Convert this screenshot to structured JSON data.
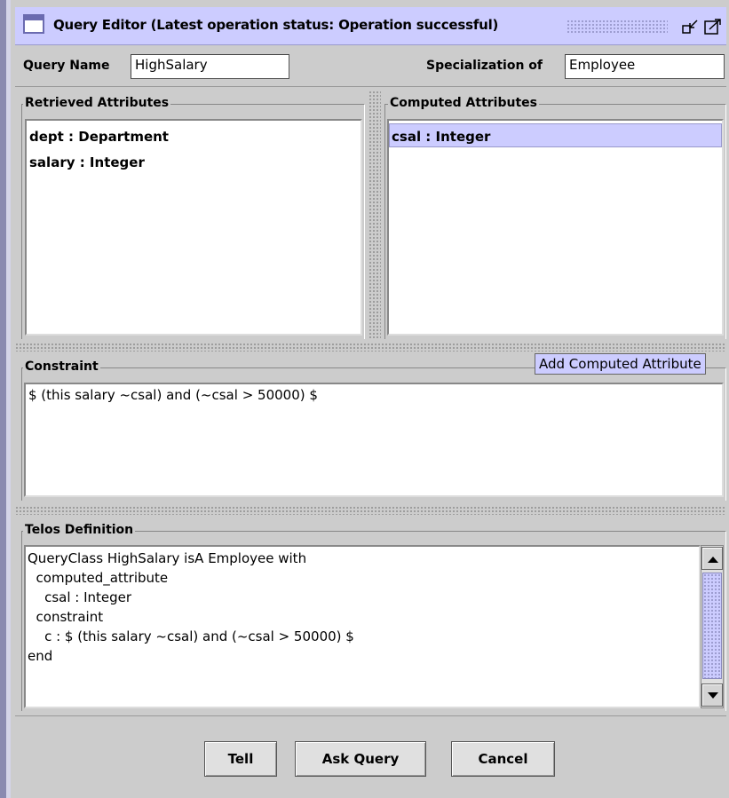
{
  "window": {
    "title": "Query Editor (Latest operation status: Operation successful)"
  },
  "header": {
    "query_name_label": "Query Name",
    "query_name_value": "HighSalary",
    "specialization_label": "Specialization of",
    "specialization_value": "Employee"
  },
  "retrieved": {
    "title": "Retrieved Attributes",
    "items": [
      "dept : Department",
      "salary : Integer"
    ]
  },
  "computed": {
    "title": "Computed Attributes",
    "items": [
      "csal : Integer"
    ]
  },
  "tooltip": "Add Computed Attribute",
  "constraint": {
    "title": "Constraint",
    "text": "$ (this salary ~csal) and (~csal > 50000) $"
  },
  "telos": {
    "title": "Telos Definition",
    "lines": [
      "QueryClass HighSalary isA Employee with",
      "  computed_attribute",
      "    csal : Integer",
      "  constraint",
      "    c : $ (this salary ~csal) and (~csal > 50000) $",
      "end"
    ]
  },
  "buttons": {
    "tell": "Tell",
    "ask_query": "Ask Query",
    "cancel": "Cancel"
  },
  "colors": {
    "accent": "#ccccff",
    "window_bg": "#cccccc",
    "selection": "#ccccff"
  },
  "icons": {
    "window": "window-icon",
    "minimize": "minimize-icon",
    "maximize": "maximize-icon",
    "scroll_up": "arrow-up-icon",
    "scroll_down": "arrow-down-icon"
  }
}
